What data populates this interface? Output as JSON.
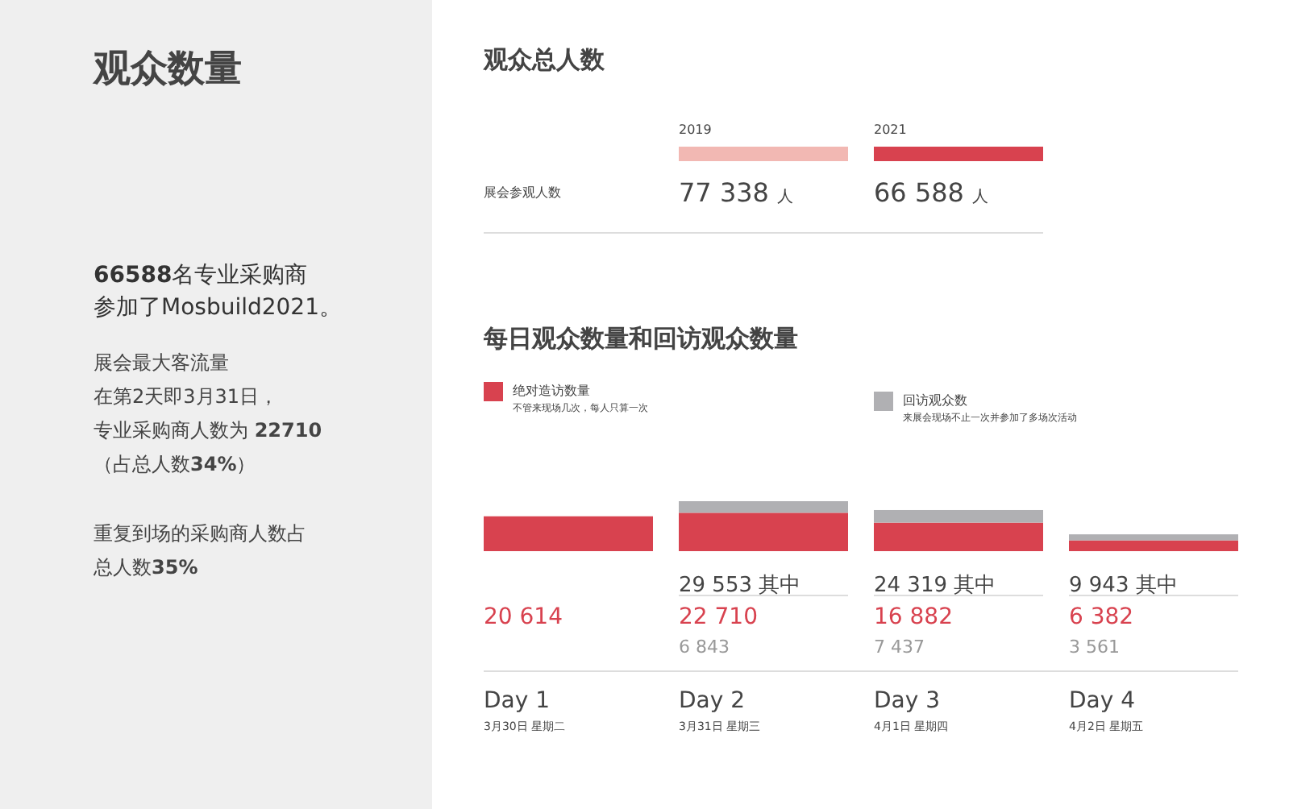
{
  "sidebar": {
    "title": "观众数量",
    "paragraphs": [
      {
        "kind": "lead",
        "lines": [
          "**66588**名专业采购商",
          "参加了Mosbuild2021。"
        ]
      },
      {
        "kind": "body",
        "lines": [
          "展会最大客流量",
          "在第2天即3月31日，",
          "专业采购商人数为 **22710**",
          "（占总人数**34%**）"
        ]
      },
      {
        "kind": "body",
        "lines": [
          "重复到场的采购商人数占",
          "总人数**35%**"
        ]
      }
    ]
  },
  "total_visitors": {
    "title": "观众总人数",
    "row_label": "展会参观人数",
    "years": [
      {
        "year": "2019",
        "color": "#f2b8b3",
        "value": "77 338",
        "unit": "人"
      },
      {
        "year": "2021",
        "color": "#d8424f",
        "value": "66 588",
        "unit": "人"
      }
    ]
  },
  "daily": {
    "title": "每日观众数量和回访观众数量",
    "legend_notes": [
      "不管来现场几次，每人只算一次",
      "来展会现场不止一次并参加了多场次活动"
    ],
    "chart_data": {
      "type": "bar",
      "stacked": true,
      "data_labels": true,
      "legend": "top",
      "categories": [
        "Day 1",
        "Day 2",
        "Day 3",
        "Day 4"
      ],
      "series": [
        {
          "name": "绝对造访数量",
          "color": "#d8424f",
          "values": [
            20614,
            22710,
            16882,
            6382
          ]
        },
        {
          "name": "回访观众数",
          "color": "#b0b0b3",
          "values": [
            null,
            6843,
            7437,
            3561
          ]
        }
      ]
    },
    "days": [
      {
        "date": "3月30日 星期二"
      },
      {
        "date": "3月31日 星期三",
        "total": "29 553",
        "total_suffix": "其中"
      },
      {
        "date": "4月1日 星期四",
        "total": "24 319",
        "total_suffix": "其中"
      },
      {
        "date": "4月2日 星期五",
        "total": "9 943",
        "total_suffix": "其中"
      }
    ]
  }
}
